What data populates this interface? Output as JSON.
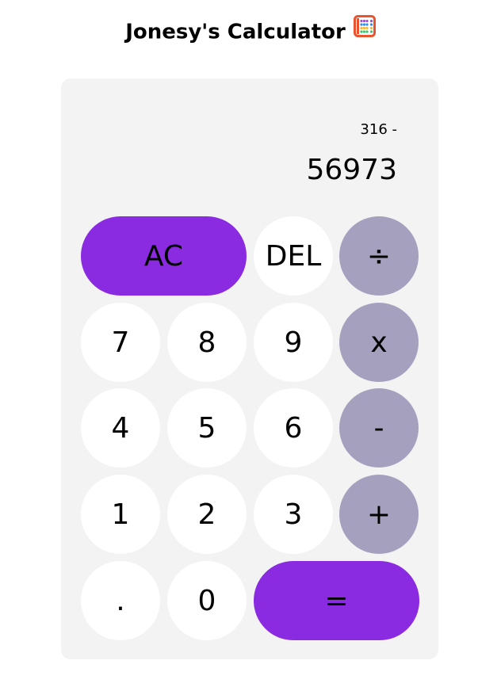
{
  "header": {
    "title": "Jonesy's Calculator"
  },
  "display": {
    "previous": "316 -",
    "current": "56973"
  },
  "buttons": {
    "ac": "AC",
    "del": "DEL",
    "divide": "÷",
    "seven": "7",
    "eight": "8",
    "nine": "9",
    "multiply": "x",
    "four": "4",
    "five": "5",
    "six": "6",
    "minus": "-",
    "one": "1",
    "two": "2",
    "three": "3",
    "plus": "+",
    "dot": ".",
    "zero": "0",
    "equals": "="
  },
  "colors": {
    "accent": "#8a2be2",
    "operator": "#a6a0bf",
    "panel": "#f3f3f3",
    "key": "#ffffff"
  },
  "icons": {
    "title_icon": "abacus-icon"
  }
}
